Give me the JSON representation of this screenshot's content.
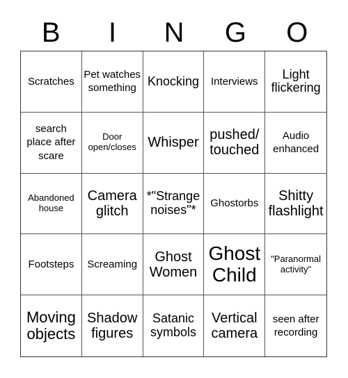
{
  "header": [
    "B",
    "I",
    "N",
    "G",
    "O"
  ],
  "cells": [
    "Scratches",
    "Pet watches something",
    "Knocking",
    "Interviews",
    "Light flickering",
    "search place after scare",
    "Door open/closes",
    "Whisper",
    "pushed/ touched",
    "Audio enhanced",
    "Abandoned house",
    "Camera glitch",
    "*\"Strange noises\"*",
    "Ghostorbs",
    "Shitty flashlight",
    "Footsteps",
    "Screaming",
    "Ghost Women",
    "Ghost Child",
    "\"Paranormal activity\"",
    "Moving objects",
    "Shadow figures",
    "Satanic symbols",
    "Vertical camera",
    "seen after recording"
  ]
}
